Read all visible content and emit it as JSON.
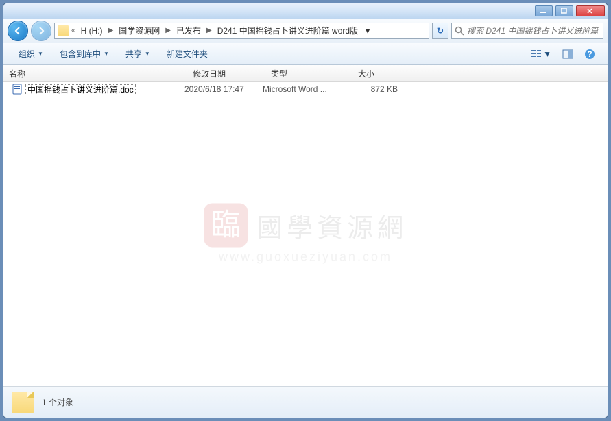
{
  "breadcrumb": {
    "drive": "H (H:)",
    "seg1": "国学资源网",
    "seg2": "已发布",
    "seg3": "D241 中国摇钱占卜讲义进阶篇 word版"
  },
  "search": {
    "placeholder": "搜索 D241 中国摇钱占卜讲义进阶篇 ..."
  },
  "toolbar": {
    "organize": "组织",
    "include": "包含到库中",
    "share": "共享",
    "newfolder": "新建文件夹"
  },
  "columns": {
    "name": "名称",
    "date": "修改日期",
    "type": "类型",
    "size": "大小"
  },
  "files": [
    {
      "name": "中国摇钱占卜讲义进阶篇.doc",
      "date": "2020/6/18 17:47",
      "type": "Microsoft Word ...",
      "size": "872 KB"
    }
  ],
  "watermark": {
    "logo": "臨",
    "text": "國學資源網",
    "url": "www.guoxueziyuan.com"
  },
  "status": {
    "count": "1 个对象"
  }
}
